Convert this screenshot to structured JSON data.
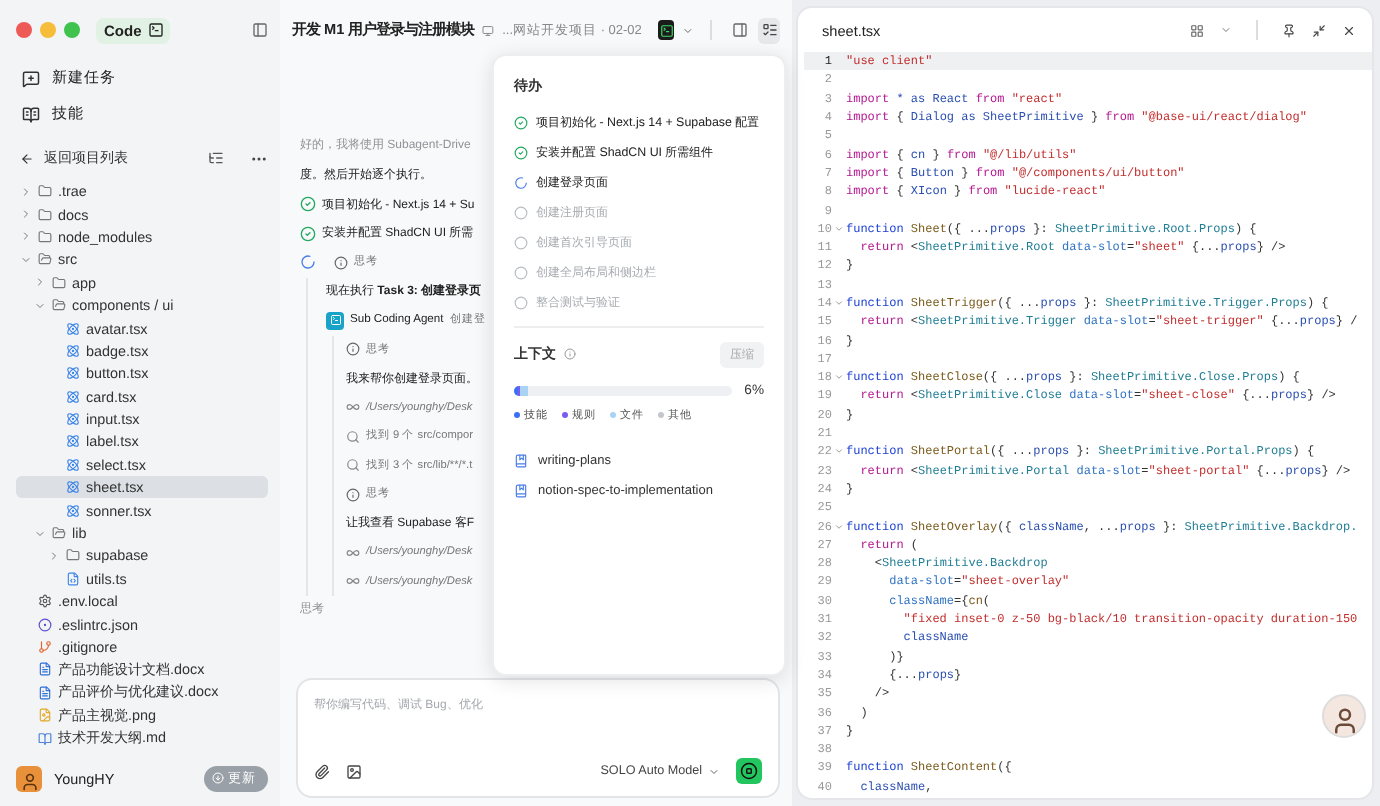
{
  "sidebar": {
    "app_tab": "Code",
    "nav": [
      {
        "kind": "new",
        "label": "新建任务"
      },
      {
        "kind": "skills",
        "label": "技能"
      }
    ],
    "back_label": "返回项目列表",
    "tree": [
      {
        "name": ".trae",
        "kind": "folder",
        "expanded": false,
        "selected": false
      },
      {
        "name": "docs",
        "kind": "folder",
        "expanded": false,
        "selected": false
      },
      {
        "name": "node_modules",
        "kind": "folder",
        "expanded": false,
        "selected": false
      },
      {
        "name": "src",
        "kind": "folder",
        "expanded": true,
        "selected": false,
        "children": [
          {
            "name": "app",
            "kind": "folder",
            "expanded": false,
            "selected": false
          },
          {
            "name": "components / ui",
            "kind": "folder",
            "expanded": true,
            "selected": false,
            "children": [
              {
                "name": "avatar.tsx",
                "kind": "react",
                "selected": false
              },
              {
                "name": "badge.tsx",
                "kind": "react",
                "selected": false
              },
              {
                "name": "button.tsx",
                "kind": "react",
                "selected": false
              },
              {
                "name": "card.tsx",
                "kind": "react",
                "selected": false
              },
              {
                "name": "input.tsx",
                "kind": "react",
                "selected": false
              },
              {
                "name": "label.tsx",
                "kind": "react",
                "selected": false
              },
              {
                "name": "select.tsx",
                "kind": "react",
                "selected": false
              },
              {
                "name": "sheet.tsx",
                "kind": "react",
                "selected": true
              },
              {
                "name": "sonner.tsx",
                "kind": "react",
                "selected": false
              }
            ]
          },
          {
            "name": "lib",
            "kind": "folder",
            "expanded": true,
            "selected": false,
            "children": [
              {
                "name": "supabase",
                "kind": "folder",
                "expanded": false,
                "selected": false
              },
              {
                "name": "utils.ts",
                "kind": "ts",
                "selected": false
              }
            ]
          }
        ]
      },
      {
        "name": ".env.local",
        "kind": "config",
        "selected": false
      },
      {
        "name": ".eslintrc.json",
        "kind": "eslint",
        "selected": false
      },
      {
        "name": ".gitignore",
        "kind": "git",
        "selected": false
      },
      {
        "name": "产品功能设计文档.docx",
        "kind": "doc",
        "selected": false
      },
      {
        "name": "产品评价与优化建议.docx",
        "kind": "doc",
        "selected": false
      },
      {
        "name": "产品主视觉.png",
        "kind": "image",
        "selected": false
      },
      {
        "name": "技术开发大纲.md",
        "kind": "markdown",
        "selected": false
      }
    ],
    "user": {
      "name": "YoungHY"
    },
    "update_button": "更新"
  },
  "chat": {
    "title": "开发 M1 用户登录与注册模块",
    "project": "...网站开发项目 · 02-02",
    "messages": [
      {
        "kind": "faded",
        "text": "好的，我将使用 Subagent-Drive"
      },
      {
        "kind": "text",
        "text": "度。然后开始逐个执行。"
      },
      {
        "kind": "done",
        "text": "项目初始化 - Next.js 14 + Su"
      },
      {
        "kind": "done",
        "text": "安装并配置 ShadCN UI 所需"
      },
      {
        "kind": "step",
        "label": "思考",
        "children": [
          {
            "kind": "text",
            "text": "现在执行 **Task 3: 创建登录页**"
          },
          {
            "kind": "agent",
            "title": "Sub Coding Agent",
            "subtitle": "创建登",
            "children": [
              {
                "kind": "thinking",
                "text": "思考"
              },
              {
                "kind": "text",
                "text": "我来帮你创建登录页面。"
              },
              {
                "kind": "file",
                "text": "/Users/younghy/Desk"
              },
              {
                "kind": "search",
                "text": "找到 9 个 src/compor"
              },
              {
                "kind": "search",
                "text": "找到 3 个 src/lib/**/*.t"
              },
              {
                "kind": "thinking",
                "text": "思考"
              },
              {
                "kind": "text",
                "text": "让我查看 Supabase 客F"
              },
              {
                "kind": "file",
                "text": "/Users/younghy/Desk"
              },
              {
                "kind": "file",
                "text": "/Users/younghy/Desk"
              }
            ]
          }
        ]
      },
      {
        "kind": "faded",
        "text": "思考"
      }
    ],
    "input": {
      "placeholder": "帮你编写代码、调试 Bug、优化"
    },
    "model": "SOLO Auto Model"
  },
  "todo_popup": {
    "title": "待办",
    "items": [
      {
        "text": "项目初始化 - Next.js 14 + Supabase 配置",
        "kind": "done"
      },
      {
        "text": "安装并配置 ShadCN UI 所需组件",
        "kind": "done"
      },
      {
        "text": "创建登录页面",
        "kind": "active"
      },
      {
        "text": "创建注册页面",
        "kind": "pending"
      },
      {
        "text": "创建首次引导页面",
        "kind": "pending"
      },
      {
        "text": "创建全局布局和侧边栏",
        "kind": "pending"
      },
      {
        "text": "整合测试与验证",
        "kind": "pending"
      }
    ],
    "context": {
      "label": "上下文",
      "compress_button": "压缩",
      "compress_disabled": true,
      "percent": "6%",
      "segments": [
        {
          "label": "技能",
          "color": "#3b6ff5",
          "level": 0.02
        },
        {
          "label": "规则",
          "color": "#7b5cf0",
          "level": 0.005
        },
        {
          "label": "文件",
          "color": "#a9d3f5",
          "level": 0.035
        },
        {
          "label": "其他",
          "color": "#c3c7cd",
          "level": 0
        }
      ]
    },
    "skills": [
      "writing-plans",
      "notion-spec-to-implementation"
    ]
  },
  "editor": {
    "filename": "sheet.tsx",
    "lines": [
      {
        "no": "1",
        "active": true,
        "tokens": [
          {
            "kind": "str",
            "text": "\"use client\""
          }
        ]
      },
      {
        "no": "2"
      },
      {
        "no": "3",
        "tokens": [
          {
            "kind": "kw",
            "text": "import"
          },
          {
            "kind": "var",
            "text": " * as React "
          },
          {
            "kind": "kw",
            "text": "from"
          },
          {
            "kind": "str",
            "text": " \"react\""
          }
        ]
      },
      {
        "no": "4",
        "tokens": [
          {
            "kind": "kw",
            "text": "import"
          },
          {
            "kind": "text",
            "text": " { "
          },
          {
            "kind": "var",
            "text": "Dialog as SheetPrimitive"
          },
          {
            "kind": "text",
            "text": " } "
          },
          {
            "kind": "kw",
            "text": "from"
          },
          {
            "kind": "str",
            "text": " \"@base-ui/react/dialog\""
          }
        ]
      },
      {
        "no": "5"
      },
      {
        "no": "6",
        "tokens": [
          {
            "kind": "kw",
            "text": "import"
          },
          {
            "kind": "text",
            "text": " { "
          },
          {
            "kind": "var",
            "text": "cn"
          },
          {
            "kind": "text",
            "text": " } "
          },
          {
            "kind": "kw",
            "text": "from"
          },
          {
            "kind": "str",
            "text": " \"@/lib/utils\""
          }
        ]
      },
      {
        "no": "7",
        "tokens": [
          {
            "kind": "kw",
            "text": "import"
          },
          {
            "kind": "text",
            "text": " { "
          },
          {
            "kind": "var",
            "text": "Button"
          },
          {
            "kind": "text",
            "text": " } "
          },
          {
            "kind": "kw",
            "text": "from"
          },
          {
            "kind": "str",
            "text": " \"@/components/ui/button\""
          }
        ]
      },
      {
        "no": "8",
        "tokens": [
          {
            "kind": "kw",
            "text": "import"
          },
          {
            "kind": "text",
            "text": " { "
          },
          {
            "kind": "var",
            "text": "XIcon"
          },
          {
            "kind": "text",
            "text": " } "
          },
          {
            "kind": "kw",
            "text": "from"
          },
          {
            "kind": "str",
            "text": " \"lucide-react\""
          }
        ]
      },
      {
        "no": "9"
      },
      {
        "no": "10",
        "foldable": true,
        "tokens": [
          {
            "kind": "decl",
            "text": "function"
          },
          {
            "kind": "fn",
            "text": " Sheet"
          },
          {
            "kind": "text",
            "text": "({ ..."
          },
          {
            "kind": "var",
            "text": "props"
          },
          {
            "kind": "text",
            "text": " }: "
          },
          {
            "kind": "type",
            "text": "SheetPrimitive.Root.Props"
          },
          {
            "kind": "text",
            "text": ") {"
          }
        ]
      },
      {
        "no": "11",
        "tokens": [
          {
            "kind": "kw",
            "text": "  return"
          },
          {
            "kind": "text",
            "text": " <"
          },
          {
            "kind": "type",
            "text": "SheetPrimitive.Root"
          },
          {
            "kind": "attr",
            "text": " data-slot"
          },
          {
            "kind": "text",
            "text": "="
          },
          {
            "kind": "str",
            "text": "\"sheet\""
          },
          {
            "kind": "text",
            "text": " {..."
          },
          {
            "kind": "var",
            "text": "props"
          },
          {
            "kind": "text",
            "text": "} />"
          }
        ]
      },
      {
        "no": "12",
        "tokens": [
          {
            "kind": "text",
            "text": "}"
          }
        ]
      },
      {
        "no": "13"
      },
      {
        "no": "14",
        "foldable": true,
        "tokens": [
          {
            "kind": "decl",
            "text": "function"
          },
          {
            "kind": "fn",
            "text": " SheetTrigger"
          },
          {
            "kind": "text",
            "text": "({ ..."
          },
          {
            "kind": "var",
            "text": "props"
          },
          {
            "kind": "text",
            "text": " }: "
          },
          {
            "kind": "type",
            "text": "SheetPrimitive.Trigger.Props"
          },
          {
            "kind": "text",
            "text": ") {"
          }
        ]
      },
      {
        "no": "15",
        "tokens": [
          {
            "kind": "kw",
            "text": "  return"
          },
          {
            "kind": "text",
            "text": " <"
          },
          {
            "kind": "type",
            "text": "SheetPrimitive.Trigger"
          },
          {
            "kind": "attr",
            "text": " data-slot"
          },
          {
            "kind": "text",
            "text": "="
          },
          {
            "kind": "str",
            "text": "\"sheet-trigger\""
          },
          {
            "kind": "text",
            "text": " {..."
          },
          {
            "kind": "var",
            "text": "props"
          },
          {
            "kind": "text",
            "text": "} /"
          }
        ]
      },
      {
        "no": "16",
        "tokens": [
          {
            "kind": "text",
            "text": "}"
          }
        ]
      },
      {
        "no": "17"
      },
      {
        "no": "18",
        "foldable": true,
        "tokens": [
          {
            "kind": "decl",
            "text": "function"
          },
          {
            "kind": "fn",
            "text": " SheetClose"
          },
          {
            "kind": "text",
            "text": "({ ..."
          },
          {
            "kind": "var",
            "text": "props"
          },
          {
            "kind": "text",
            "text": " }: "
          },
          {
            "kind": "type",
            "text": "SheetPrimitive.Close.Props"
          },
          {
            "kind": "text",
            "text": ") {"
          }
        ]
      },
      {
        "no": "19",
        "tokens": [
          {
            "kind": "kw",
            "text": "  return"
          },
          {
            "kind": "text",
            "text": " <"
          },
          {
            "kind": "type",
            "text": "SheetPrimitive.Close"
          },
          {
            "kind": "attr",
            "text": " data-slot"
          },
          {
            "kind": "text",
            "text": "="
          },
          {
            "kind": "str",
            "text": "\"sheet-close\""
          },
          {
            "kind": "text",
            "text": " {..."
          },
          {
            "kind": "var",
            "text": "props"
          },
          {
            "kind": "text",
            "text": "} />"
          }
        ]
      },
      {
        "no": "20",
        "tokens": [
          {
            "kind": "text",
            "text": "}"
          }
        ]
      },
      {
        "no": "21"
      },
      {
        "no": "22",
        "foldable": true,
        "tokens": [
          {
            "kind": "decl",
            "text": "function"
          },
          {
            "kind": "fn",
            "text": " SheetPortal"
          },
          {
            "kind": "text",
            "text": "({ ..."
          },
          {
            "kind": "var",
            "text": "props"
          },
          {
            "kind": "text",
            "text": " }: "
          },
          {
            "kind": "type",
            "text": "SheetPrimitive.Portal.Props"
          },
          {
            "kind": "text",
            "text": ") {"
          }
        ]
      },
      {
        "no": "23",
        "tokens": [
          {
            "kind": "kw",
            "text": "  return"
          },
          {
            "kind": "text",
            "text": " <"
          },
          {
            "kind": "type",
            "text": "SheetPrimitive.Portal"
          },
          {
            "kind": "attr",
            "text": " data-slot"
          },
          {
            "kind": "text",
            "text": "="
          },
          {
            "kind": "str",
            "text": "\"sheet-portal\""
          },
          {
            "kind": "text",
            "text": " {..."
          },
          {
            "kind": "var",
            "text": "props"
          },
          {
            "kind": "text",
            "text": "} />"
          }
        ]
      },
      {
        "no": "24",
        "tokens": [
          {
            "kind": "text",
            "text": "}"
          }
        ]
      },
      {
        "no": "25"
      },
      {
        "no": "26",
        "foldable": true,
        "tokens": [
          {
            "kind": "decl",
            "text": "function"
          },
          {
            "kind": "fn",
            "text": " SheetOverlay"
          },
          {
            "kind": "text",
            "text": "({ "
          },
          {
            "kind": "var",
            "text": "className"
          },
          {
            "kind": "text",
            "text": ", ..."
          },
          {
            "kind": "var",
            "text": "props"
          },
          {
            "kind": "text",
            "text": " }: "
          },
          {
            "kind": "type",
            "text": "SheetPrimitive.Backdrop."
          }
        ]
      },
      {
        "no": "27",
        "tokens": [
          {
            "kind": "kw",
            "text": "  return"
          },
          {
            "kind": "text",
            "text": " ("
          }
        ]
      },
      {
        "no": "28",
        "tokens": [
          {
            "kind": "text",
            "text": "    <"
          },
          {
            "kind": "type",
            "text": "SheetPrimitive.Backdrop"
          }
        ]
      },
      {
        "no": "29",
        "tokens": [
          {
            "kind": "attr",
            "text": "      data-slot"
          },
          {
            "kind": "text",
            "text": "="
          },
          {
            "kind": "str",
            "text": "\"sheet-overlay\""
          }
        ]
      },
      {
        "no": "30",
        "tokens": [
          {
            "kind": "attr",
            "text": "      className"
          },
          {
            "kind": "text",
            "text": "={"
          },
          {
            "kind": "fn",
            "text": "cn"
          },
          {
            "kind": "text",
            "text": "("
          }
        ]
      },
      {
        "no": "31",
        "tokens": [
          {
            "kind": "str",
            "text": "        \"fixed inset-0 z-50 bg-black/10 transition-opacity duration-150"
          }
        ]
      },
      {
        "no": "32",
        "tokens": [
          {
            "kind": "var",
            "text": "        className"
          }
        ]
      },
      {
        "no": "33",
        "tokens": [
          {
            "kind": "text",
            "text": "      )}"
          }
        ]
      },
      {
        "no": "34",
        "tokens": [
          {
            "kind": "text",
            "text": "      {..."
          },
          {
            "kind": "var",
            "text": "props"
          },
          {
            "kind": "text",
            "text": "}"
          }
        ]
      },
      {
        "no": "35",
        "tokens": [
          {
            "kind": "text",
            "text": "    />"
          }
        ]
      },
      {
        "no": "36",
        "tokens": [
          {
            "kind": "text",
            "text": "  )"
          }
        ]
      },
      {
        "no": "37",
        "tokens": [
          {
            "kind": "text",
            "text": "}"
          }
        ]
      },
      {
        "no": "38"
      },
      {
        "no": "39",
        "tokens": [
          {
            "kind": "decl",
            "text": "function"
          },
          {
            "kind": "fn",
            "text": " SheetContent"
          },
          {
            "kind": "text",
            "text": "({"
          }
        ]
      },
      {
        "no": "40",
        "tokens": [
          {
            "kind": "var",
            "text": "  className"
          },
          {
            "kind": "text",
            "text": ","
          }
        ]
      }
    ]
  }
}
